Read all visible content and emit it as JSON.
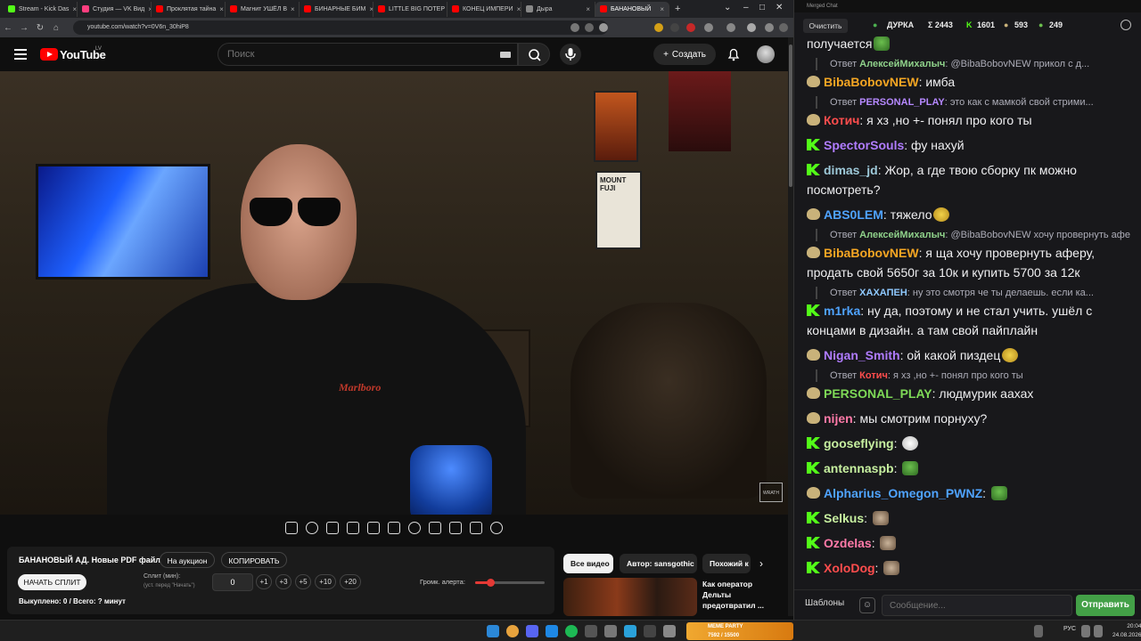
{
  "browser": {
    "tabs": [
      {
        "label": "Stream - Kick Das",
        "color": "#53fc18"
      },
      {
        "label": "Студия — VK Вид",
        "color": "#ff3e7f"
      },
      {
        "label": "Проклятая тайна",
        "color": "#ff0000"
      },
      {
        "label": "Магнит УШЁЛ В",
        "color": "#ff0000"
      },
      {
        "label": "БИНАРНЫЕ БИМ",
        "color": "#ff0000"
      },
      {
        "label": "LITTLE BIG ПОТЕР",
        "color": "#ff0000"
      },
      {
        "label": "КОНЕЦ ИМПЕРИ",
        "color": "#ff0000"
      },
      {
        "label": "Дыра",
        "color": "#888888"
      },
      {
        "label": "БАНАНОВЫЙ",
        "color": "#ff0000",
        "active": true
      }
    ],
    "url": "youtube.com/watch?v=0V6n_30hiP8"
  },
  "youtube": {
    "logo_text": "YouTube",
    "country": "LV",
    "search_placeholder": "Поиск",
    "create_label": "Создать"
  },
  "video": {
    "shirt_logo": "Marlboro",
    "poster_text": "MOUNT FUJI",
    "watermark": "WRATH"
  },
  "auction": {
    "title": "БАНАНОВЫЙ АД. Новые PDF файлы.",
    "to_auction": "На аукцион",
    "copy": "КОПИРОВАТЬ",
    "start_split": "НАЧАТЬ СПЛИТ",
    "split_label": "Сплит (мин):",
    "split_hint": "(уст. перед \"Начать\")",
    "split_value": "0",
    "increments": [
      "+1",
      "+3",
      "+5",
      "+10",
      "+20"
    ],
    "volume_label": "Громк. алерта:",
    "volume_level": 0.22,
    "bought": "Выкуплено: 0 / Всего: ? минут"
  },
  "related": {
    "chips": [
      "Все видео",
      "Автор: sansgothic",
      "Похожий к"
    ],
    "video_title": "Как оператор Дельты предотвратил ..."
  },
  "chat": {
    "window_title": "Merged Chat",
    "clear_label": "Очистить",
    "stats": {
      "name": "ДУРКА",
      "total": "Σ 2443",
      "kick": "1601",
      "twitch": "593",
      "other": "249"
    },
    "messages": [
      {
        "type": "msg",
        "nick": "",
        "color": "#efeff1",
        "badge": "",
        "text": "получается",
        "emote": "frog"
      },
      {
        "type": "reply",
        "to": "АлексейМихалыч",
        "to_color": "#8fd18a",
        "text": "@BibaBobovNEW прикол с д..."
      },
      {
        "type": "msg",
        "nick": "BibaBobovNEW",
        "color": "#f5a623",
        "badge": "ttv",
        "text": "имба"
      },
      {
        "type": "reply",
        "to": "PERSONAL_PLAY",
        "to_color": "#b689ff",
        "text": "это как с мамкой свой стрими..."
      },
      {
        "type": "msg",
        "nick": "Котич",
        "color": "#ff4d4d",
        "badge": "ttv",
        "text": "я хз ,но +- понял про кого ты"
      },
      {
        "type": "msg",
        "nick": "SpectorSouls",
        "color": "#b07cff",
        "badge": "kick",
        "text": "фу нахуй"
      },
      {
        "type": "msg",
        "nick": "dimas_jd",
        "color": "#9ec9d9",
        "badge": "kick",
        "text": "Жор, а где твою сборку пк можно посмотреть?"
      },
      {
        "type": "msg",
        "nick": "ABS0LEM",
        "color": "#4fa3ff",
        "badge": "ttv",
        "text": "тяжело",
        "emote": "smile"
      },
      {
        "type": "reply",
        "to": "АлексейМихалыч",
        "to_color": "#8fd18a",
        "text": "@BibaBobovNEW хочу провернуть афе..."
      },
      {
        "type": "msg",
        "nick": "BibaBobovNEW",
        "color": "#f5a623",
        "badge": "ttv",
        "text": "я ща хочу провернуть аферу, продать свой 5650г за 10к и купить 5700 за 12к"
      },
      {
        "type": "reply",
        "to": "ХАХАПЕН",
        "to_color": "#8fc9ff",
        "text": "ну это смотря че ты делаешь. если ка..."
      },
      {
        "type": "msg",
        "nick": "m1rka",
        "color": "#4fa3ff",
        "badge": "kick",
        "text": "ну да, поэтому и не стал учить. ушёл с концами в дизайн. а там свой пайплайн"
      },
      {
        "type": "msg",
        "nick": "Nigan_Smith",
        "color": "#b07cff",
        "badge": "ttv",
        "text": "ой какой пиздец",
        "emote": "smile"
      },
      {
        "type": "reply",
        "to": "Котич",
        "to_color": "#ff4d4d",
        "text": "я хз ,но +- понял про кого ты"
      },
      {
        "type": "msg",
        "nick": "PERSONAL_PLAY",
        "color": "#7ed957",
        "badge": "ttv",
        "text": "людмурик аахах"
      },
      {
        "type": "msg",
        "nick": "nijen",
        "color": "#ff7aa8",
        "badge": "ttv",
        "text": "мы смотрим порнуху?"
      },
      {
        "type": "msg",
        "nick": "gooseflying",
        "color": "#c7f0a0",
        "badge": "kick",
        "text": "",
        "emote": "eyes"
      },
      {
        "type": "msg",
        "nick": "antennaspb",
        "color": "#c7f0a0",
        "badge": "kick",
        "text": "",
        "emote": "frog"
      },
      {
        "type": "msg",
        "nick": "Alpharius_Omegon_PWNZ",
        "color": "#4fa3ff",
        "badge": "ttv",
        "text": "",
        "emote": "frog"
      },
      {
        "type": "msg",
        "nick": "Selkus",
        "color": "#c7f0a0",
        "badge": "kick",
        "text": "",
        "emote": "cat"
      },
      {
        "type": "msg",
        "nick": "Ozdelas",
        "color": "#ff7aa8",
        "badge": "kick",
        "text": "",
        "emote": "cat"
      },
      {
        "type": "msg",
        "nick": "XoloDog",
        "color": "#ff4d4d",
        "badge": "kick",
        "text": "",
        "emote": "cat"
      }
    ],
    "templates_label": "Шаблоны",
    "input_placeholder": "Сообщение...",
    "send_label": "Отправить"
  },
  "taskbar": {
    "widget_title": "MEME PARTY",
    "widget_value": "7592 / 15500",
    "lang": "РУС",
    "time": "20:04",
    "date": "24.08.2026"
  }
}
